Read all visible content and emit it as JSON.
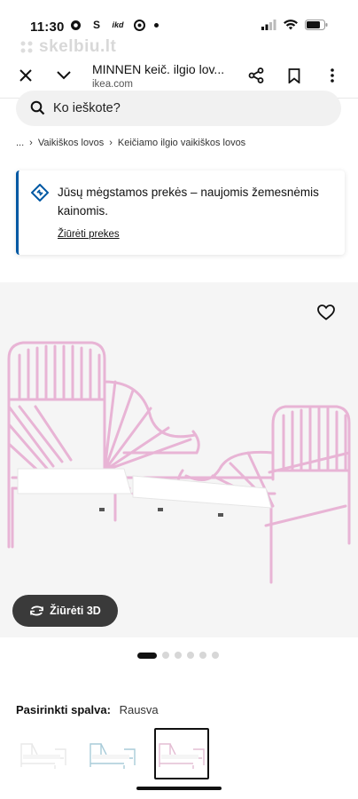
{
  "status": {
    "time": "11:30",
    "app_icons": [
      "S",
      "ikd"
    ]
  },
  "watermark": "skelbiu.lt",
  "browser": {
    "title": "MINNEN keič. ilgio lov...",
    "domain": "ikea.com"
  },
  "search": {
    "placeholder": "Ko ieškote?"
  },
  "breadcrumbs": [
    "...",
    "Vaikiškos lovos",
    "Keičiamo ilgio vaikiškos lovos"
  ],
  "notice": {
    "text": "Jūsų mėgstamos prekės – naujomis žemesnėmis kainomis.",
    "link": "Žiūrėti prekes"
  },
  "product": {
    "view3d_label": "Žiūrėti 3D",
    "image_count": 6,
    "active_image": 1
  },
  "colors": {
    "label": "Pasirinkti spalva:",
    "selected_value": "Rausva",
    "swatches": [
      {
        "name": "balta",
        "color": "#f2f2f2",
        "selected": false
      },
      {
        "name": "mėlyna",
        "color": "#a9ccd9",
        "selected": false
      },
      {
        "name": "rausva",
        "color": "#e4bdd4",
        "selected": true
      }
    ]
  },
  "theme": {
    "accent": "#0058a3",
    "bed_color": "#e8b4d5",
    "dark_button": "#3a3a3a"
  }
}
